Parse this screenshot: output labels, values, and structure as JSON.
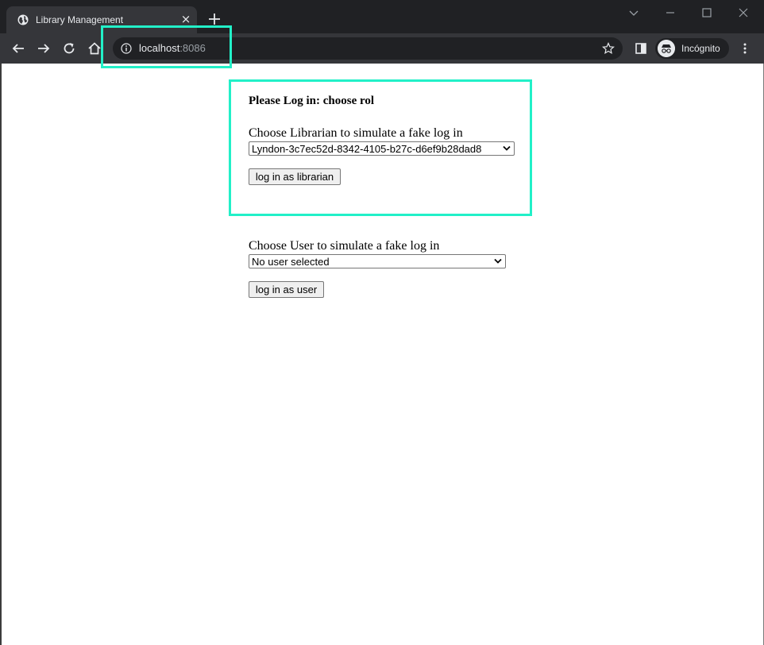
{
  "browser": {
    "tab_title": "Library Management",
    "url_host": "localhost",
    "url_port": ":8086",
    "profile_label": "Incógnito"
  },
  "login": {
    "title": "Please Log in: choose rol",
    "librarian_label": "Choose Librarian to simulate a fake log in",
    "librarian_selected": "Lyndon-3c7ec52d-8342-4105-b27c-d6ef9b28dad8",
    "librarian_button": "log in as librarian",
    "user_label": "Choose User to simulate a fake log in",
    "user_selected": "No user selected",
    "user_button": "log in as user"
  },
  "colors": {
    "highlight": "#22f0c8",
    "chrome_dark": "#202124",
    "chrome_toolbar": "#35363a"
  }
}
